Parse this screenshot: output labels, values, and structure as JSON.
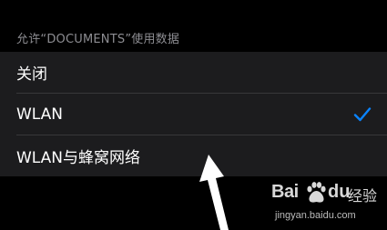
{
  "section": {
    "header": "允许“DOCUMENTS”使用数据"
  },
  "options": [
    {
      "label": "关闭",
      "selected": false
    },
    {
      "label": "WLAN",
      "selected": true
    },
    {
      "label": "WLAN与蜂窝网络",
      "selected": false
    }
  ],
  "colors": {
    "background": "#000000",
    "group_background": "#1c1c1e",
    "separator": "#38383a",
    "header_text": "#8d8d92",
    "label_text": "#ffffff",
    "checkmark": "#0a84ff",
    "annotation_arrow": "#ffffff"
  },
  "icons": {
    "selected_indicator": "checkmark-icon",
    "annotation": "arrow-pointer-icon",
    "watermark_logo": "baidu-paw-logo"
  },
  "watermark": {
    "brand_left": "Bai",
    "brand_right": "du",
    "product": "经验",
    "url": "jingyan.baidu.com"
  }
}
